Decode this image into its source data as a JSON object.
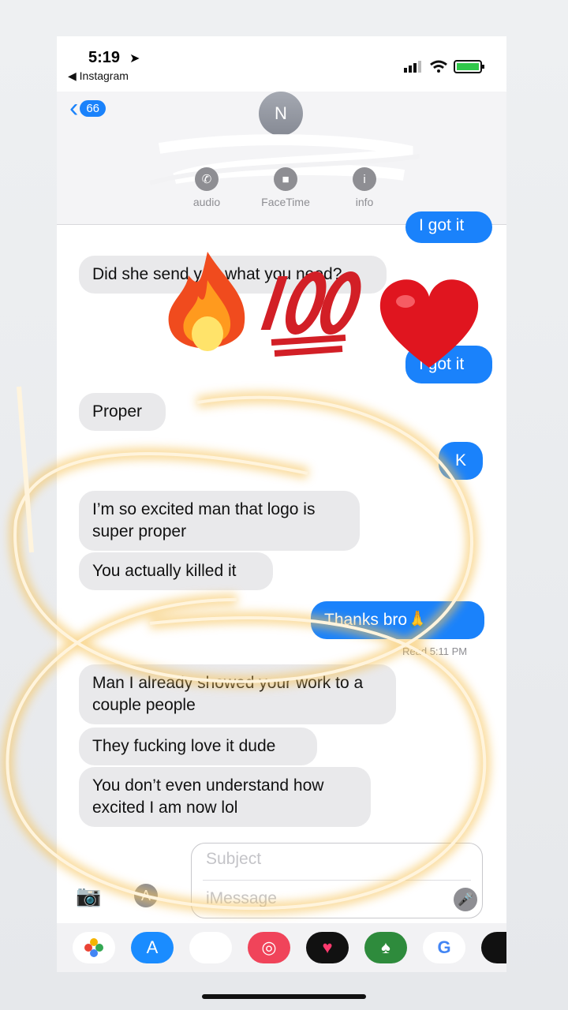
{
  "status": {
    "time": "5:19",
    "back_app": "◀ Instagram"
  },
  "header": {
    "back_count": "66",
    "avatar_initial": "N",
    "contact_name": "",
    "actions": [
      {
        "label": "audio",
        "icon": "phone-icon"
      },
      {
        "label": "FaceTime",
        "icon": "video-icon"
      },
      {
        "label": "info",
        "icon": "info-icon"
      }
    ]
  },
  "messages": [
    {
      "side": "sent",
      "text": "I got it"
    },
    {
      "side": "received",
      "text": "Did she send you what you need?"
    },
    {
      "side": "sent",
      "text": "I got it"
    },
    {
      "side": "received",
      "text": "Proper"
    },
    {
      "side": "sent",
      "text": "K"
    },
    {
      "side": "received",
      "text": "I’m so excited man that logo is super proper"
    },
    {
      "side": "received",
      "text": "You actually killed it"
    },
    {
      "side": "sent",
      "text": "Thanks bro🙏"
    },
    {
      "side": "received",
      "text": "Man I already showed your work to a couple people"
    },
    {
      "side": "received",
      "text": "They fucking love it dude"
    },
    {
      "side": "received",
      "text": "You don’t even understand how excited I am now lol"
    }
  ],
  "read_receipt": "Read 5:11 PM",
  "input": {
    "subject_placeholder": "Subject",
    "message_placeholder": "iMessage"
  },
  "stickers": [
    "fire-emoji",
    "hundred-emoji",
    "heart-emoji"
  ],
  "dock_apps": [
    "photos",
    "app-store",
    "monkey",
    "search-globe",
    "heart-app",
    "solitaire",
    "google",
    "more"
  ],
  "colors": {
    "accent": "#1a82fb",
    "received_bubble": "#e9e9eb",
    "glow": "#f6c35a"
  }
}
